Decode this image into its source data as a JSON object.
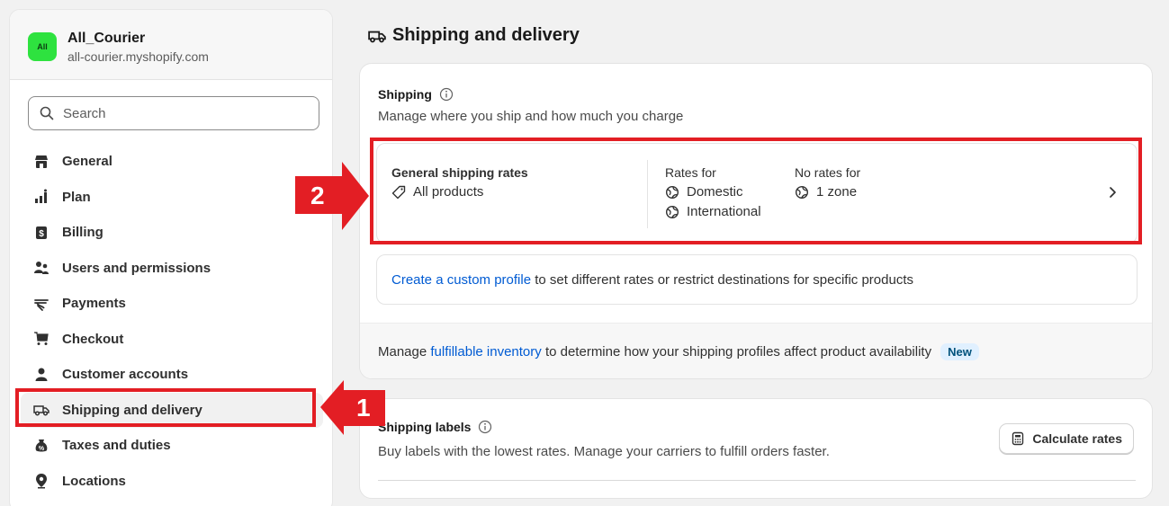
{
  "store": {
    "avatar_text": "All",
    "name": "All_Courier",
    "domain": "all-courier.myshopify.com"
  },
  "search": {
    "placeholder": "Search"
  },
  "nav": [
    {
      "label": "General",
      "icon": "store-icon"
    },
    {
      "label": "Plan",
      "icon": "plan-chart-icon"
    },
    {
      "label": "Billing",
      "icon": "billing-icon"
    },
    {
      "label": "Users and permissions",
      "icon": "users-icon"
    },
    {
      "label": "Payments",
      "icon": "payments-icon"
    },
    {
      "label": "Checkout",
      "icon": "cart-icon"
    },
    {
      "label": "Customer accounts",
      "icon": "person-icon"
    },
    {
      "label": "Shipping and delivery",
      "icon": "truck-icon",
      "active": true
    },
    {
      "label": "Taxes and duties",
      "icon": "taxes-icon"
    },
    {
      "label": "Locations",
      "icon": "location-pin-icon"
    }
  ],
  "page": {
    "title": "Shipping and delivery"
  },
  "shipping": {
    "title": "Shipping",
    "description": "Manage where you ship and how much you charge",
    "rates": {
      "general_title": "General shipping rates",
      "general_scope": "All products",
      "rates_for_title": "Rates for",
      "rates_for": [
        "Domestic",
        "International"
      ],
      "no_rates_title": "No rates for",
      "no_rates": "1 zone"
    },
    "custom_profile": {
      "link": "Create a custom profile",
      "text": " to set different rates or restrict destinations for specific products"
    },
    "footer": {
      "prefix": "Manage ",
      "link": "fulfillable inventory",
      "suffix": " to determine how your shipping profiles affect product availability",
      "badge": "New"
    }
  },
  "labels": {
    "title": "Shipping labels",
    "description": "Buy labels with the lowest rates. Manage your carriers to fulfill orders faster.",
    "button": "Calculate rates"
  },
  "annotations": {
    "marker_1": "1",
    "marker_2": "2",
    "color": "#e31e24"
  },
  "colors": {
    "link": "#005bd3",
    "badge_bg": "#e0f0ff",
    "avatar": "#2ee23f"
  }
}
